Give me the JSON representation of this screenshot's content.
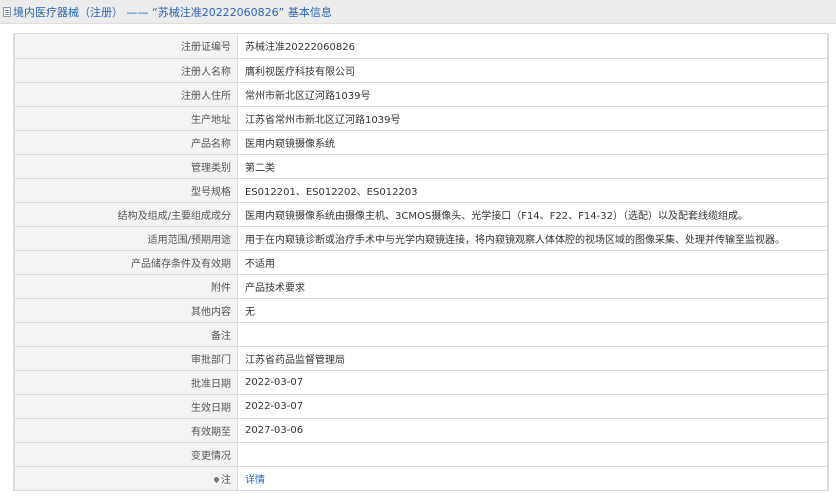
{
  "header": {
    "title": "境内医疗器械（注册） —— “苏械注准20222060826” 基本信息"
  },
  "rows": [
    {
      "label": "注册证编号",
      "value": "苏械注准20222060826"
    },
    {
      "label": "注册人名称",
      "value": "膺利视医疗科技有限公司"
    },
    {
      "label": "注册人住所",
      "value": "常州市新北区辽河路1039号"
    },
    {
      "label": "生产地址",
      "value": "江苏省常州市新北区辽河路1039号"
    },
    {
      "label": "产品名称",
      "value": "医用内窥镜摄像系统"
    },
    {
      "label": "管理类别",
      "value": "第二类"
    },
    {
      "label": "型号规格",
      "value": "ES012201、ES012202、ES012203"
    },
    {
      "label": "结构及组成/主要组成成分",
      "value": "医用内窥镜摄像系统由摄像主机、3CMOS摄像头、光学接口（F14、F22、F14-32）（选配）以及配套线缆组成。"
    },
    {
      "label": "适用范围/预期用途",
      "value": "用于在内窥镜诊断或治疗手术中与光学内窥镜连接，将内窥镜观察人体体腔的视场区域的图像采集、处理并传输至监视器。"
    },
    {
      "label": "产品储存条件及有效期",
      "value": "不适用"
    },
    {
      "label": "附件",
      "value": "产品技术要求"
    },
    {
      "label": "其他内容",
      "value": "无"
    },
    {
      "label": "备注",
      "value": ""
    },
    {
      "label": "审批部门",
      "value": "江苏省药品监督管理局"
    },
    {
      "label": "批准日期",
      "value": "2022-03-07"
    },
    {
      "label": "生效日期",
      "value": "2022-03-07"
    },
    {
      "label": "有效期至",
      "value": "2027-03-06"
    },
    {
      "label": "变更情况",
      "value": ""
    },
    {
      "label": "注",
      "value": "详情"
    }
  ]
}
